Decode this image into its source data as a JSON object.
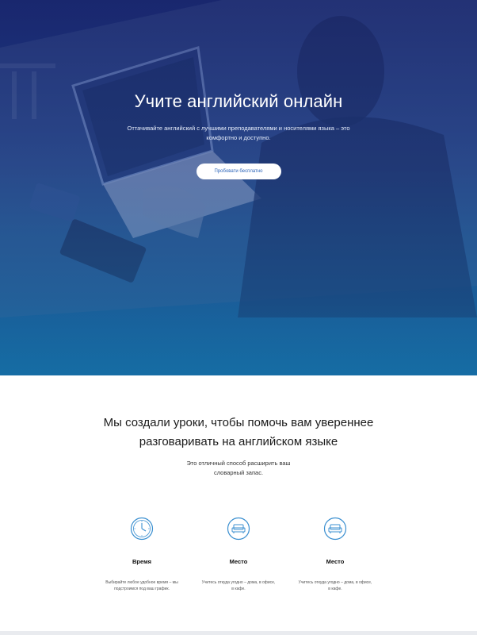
{
  "hero": {
    "title": "Учите английский онлайн",
    "subtitle_line1": "Оттачивайте английский с лучшими преподавателями и носителями языка – это",
    "subtitle_line2": "комфортно и доступно.",
    "cta_label": "Пробовати бесплатно",
    "background_color": "#1f3e86",
    "accent_color": "#2a63b8"
  },
  "intro": {
    "title_line1": "Мы создали уроки, чтобы помочь вам увереннее",
    "title_line2": "разговаривать на английском языке",
    "subtitle_line1": "Это отличный способ расширить ваш",
    "subtitle_line2": "словарный запас."
  },
  "features": [
    {
      "icon": "clock-icon",
      "name": "Время",
      "desc_line1": "Выбирайте любое удобное время – мы",
      "desc_line2": "подстроимся под ваш график."
    },
    {
      "icon": "sofa-icon",
      "name": "Место",
      "desc_line1": "Учитесь откуда угодно – дома, в офисе,",
      "desc_line2": "в кафе."
    },
    {
      "icon": "sofa-icon",
      "name": "Место",
      "desc_line1": "Учитесь откуда угодно – дома, в офисе,",
      "desc_line2": "в кафе."
    }
  ],
  "icon_color": "#3a8fd0"
}
